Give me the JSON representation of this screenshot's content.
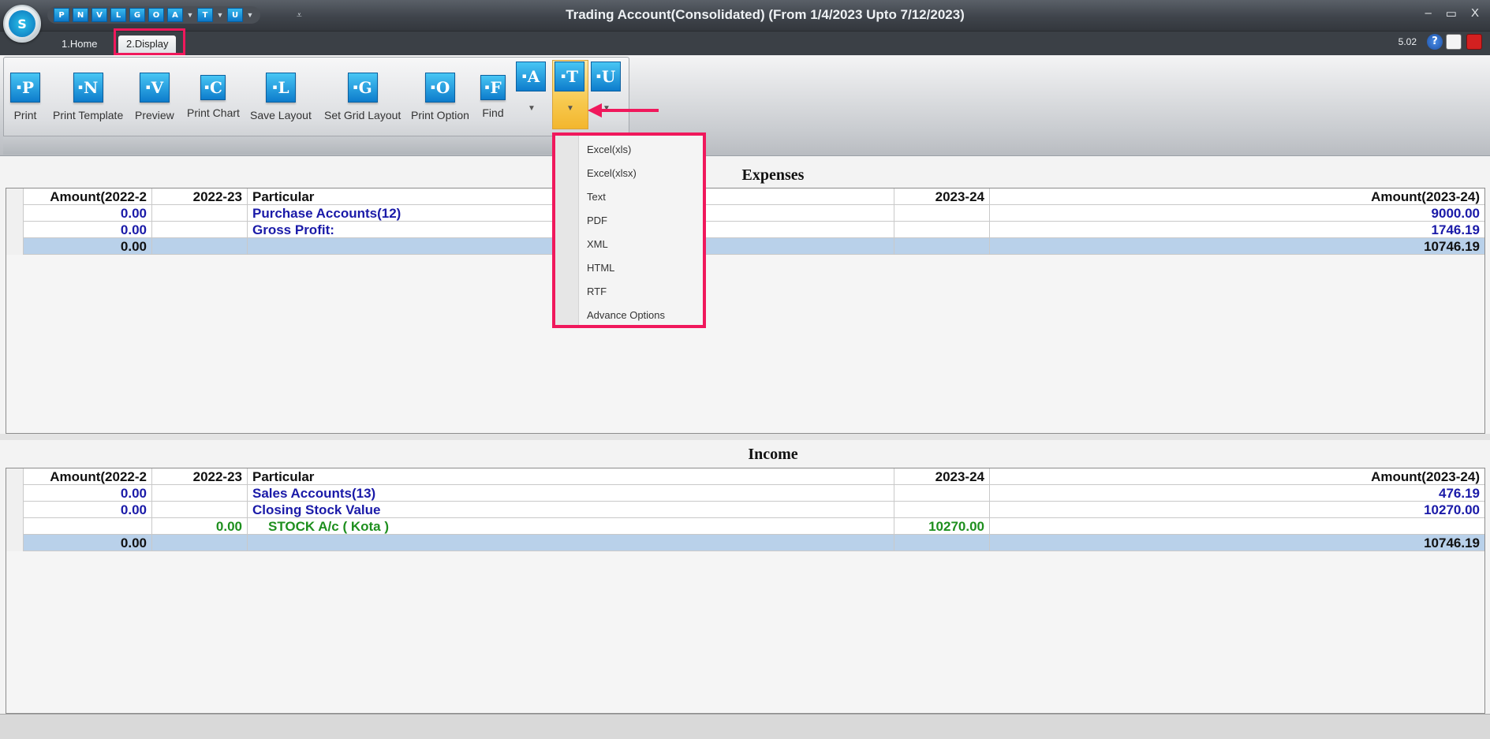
{
  "app": {
    "title": "Trading Account(Consolidated) (From 1/4/2023 Upto 7/12/2023)",
    "logo_letter": "S",
    "version": "5.02",
    "window_controls": [
      "–",
      "▭",
      "X"
    ]
  },
  "quick_access": {
    "icons": [
      "P",
      "N",
      "V",
      "L",
      "G",
      "O",
      "A",
      "T",
      "U"
    ]
  },
  "tabs": [
    {
      "label": "1.Home"
    },
    {
      "label": "2.Display"
    }
  ],
  "ribbon": {
    "buttons": [
      {
        "letter": "P",
        "label": "Print"
      },
      {
        "letter": "N",
        "label": "Print Template"
      },
      {
        "letter": "V",
        "label": "Preview"
      },
      {
        "letter": "C",
        "label": "Print Chart"
      },
      {
        "letter": "L",
        "label": "Save Layout"
      },
      {
        "letter": "G",
        "label": "Set Grid Layout"
      },
      {
        "letter": "O",
        "label": "Print Option"
      },
      {
        "letter": "F",
        "label": "Find"
      }
    ],
    "split_buttons": [
      {
        "letter": "A"
      },
      {
        "letter": "T"
      },
      {
        "letter": "U"
      }
    ]
  },
  "export_menu": {
    "items": [
      "Excel(xls)",
      "Excel(xlsx)",
      "Text",
      "PDF",
      "XML",
      "HTML",
      "RTF",
      "Advance Options"
    ]
  },
  "expenses": {
    "title": "Expenses",
    "columns": [
      "Amount(2022-2",
      "2022-23",
      "Particular",
      "2023-24",
      "Amount(2023-24)"
    ],
    "rows": [
      {
        "amt_prev": "0.00",
        "prev": "",
        "particular": "Purchase Accounts(12)",
        "curr": "",
        "amt_curr": "9000.00"
      },
      {
        "amt_prev": "0.00",
        "prev": "",
        "particular": "Gross Profit:",
        "curr": "",
        "amt_curr": "1746.19"
      }
    ],
    "total": {
      "amt_prev": "0.00",
      "amt_curr": "10746.19"
    }
  },
  "income": {
    "title": "Income",
    "columns": [
      "Amount(2022-2",
      "2022-23",
      "Particular",
      "2023-24",
      "Amount(2023-24)"
    ],
    "rows": [
      {
        "amt_prev": "0.00",
        "prev": "",
        "particular": "Sales Accounts(13)",
        "curr": "",
        "amt_curr": "476.19"
      },
      {
        "amt_prev": "0.00",
        "prev": "",
        "particular": "Closing Stock Value",
        "curr": "",
        "amt_curr": "10270.00"
      },
      {
        "amt_prev": "",
        "prev": "0.00",
        "particular": "STOCK A/c ( Kota )",
        "curr": "10270.00",
        "amt_curr": ""
      }
    ],
    "total": {
      "amt_prev": "0.00",
      "amt_curr": "10746.19"
    }
  },
  "colors": {
    "highlight": "#f0185c",
    "total_row": "#b9d1ea",
    "account_text": "#1a1aa8",
    "sub_account_text": "#1e8f1e"
  }
}
